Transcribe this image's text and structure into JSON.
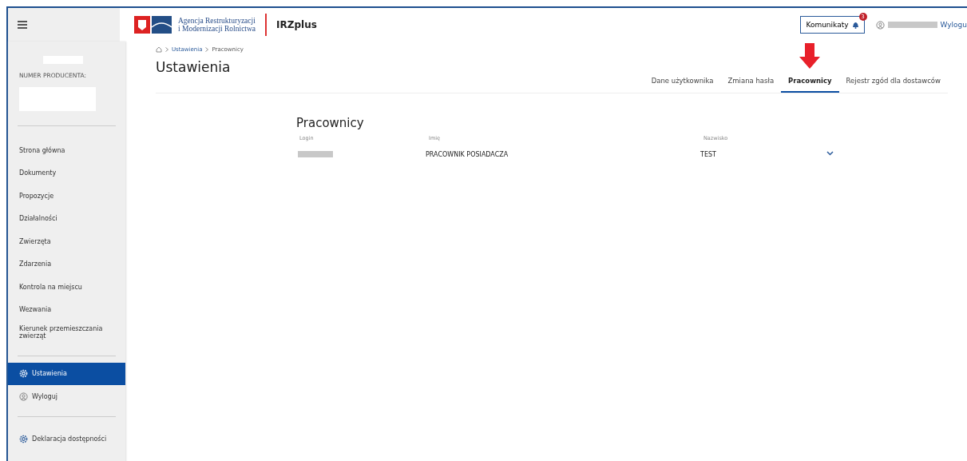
{
  "header": {
    "agency_name": [
      "Agencja Restrukturyzacji",
      "i Modernizacji Rolnictwa"
    ],
    "app_name": "IRZplus",
    "messages_button": "Komunikaty",
    "messages_count": "3",
    "logout_link": "Wylogu"
  },
  "profile": {
    "producer_label": "NUMER PRODUCENTA:"
  },
  "sidebar": {
    "items": [
      {
        "label": "Strona główna",
        "selected": false
      },
      {
        "label": "Dokumenty",
        "selected": false
      },
      {
        "label": "Propozycje",
        "selected": false
      },
      {
        "label": "Działalności",
        "selected": false
      },
      {
        "label": "Zwierzęta",
        "selected": false
      },
      {
        "label": "Zdarzenia",
        "selected": false
      },
      {
        "label": "Kontrola na miejscu",
        "selected": false
      },
      {
        "label": "Wezwania",
        "selected": false
      },
      {
        "label": "Kierunek przemieszczania zwierząt",
        "selected": false
      }
    ],
    "settings_items": [
      {
        "label": "Ustawienia",
        "selected": true,
        "kind": "gear"
      },
      {
        "label": "Wyloguj",
        "selected": false,
        "kind": "user"
      }
    ],
    "footer_items": [
      {
        "label": "Deklaracja dostępności",
        "selected": false,
        "kind": "gear"
      }
    ]
  },
  "breadcrumb": [
    "Ustawienia",
    "Pracownicy"
  ],
  "page_title": "Ustawienia",
  "tabs": [
    {
      "label": "Dane użytkownika",
      "selected": false
    },
    {
      "label": "Zmiana hasła",
      "selected": false
    },
    {
      "label": "Pracownicy",
      "selected": true
    },
    {
      "label": "Rejestr zgód dla dostawców",
      "selected": false
    }
  ],
  "section_title": "Pracownicy",
  "table": {
    "columns": [
      "Login",
      "Imię",
      "Nazwisko"
    ],
    "rows": [
      {
        "name": "PRACOWNIK POSIADACZA",
        "surname": "TEST"
      }
    ]
  }
}
